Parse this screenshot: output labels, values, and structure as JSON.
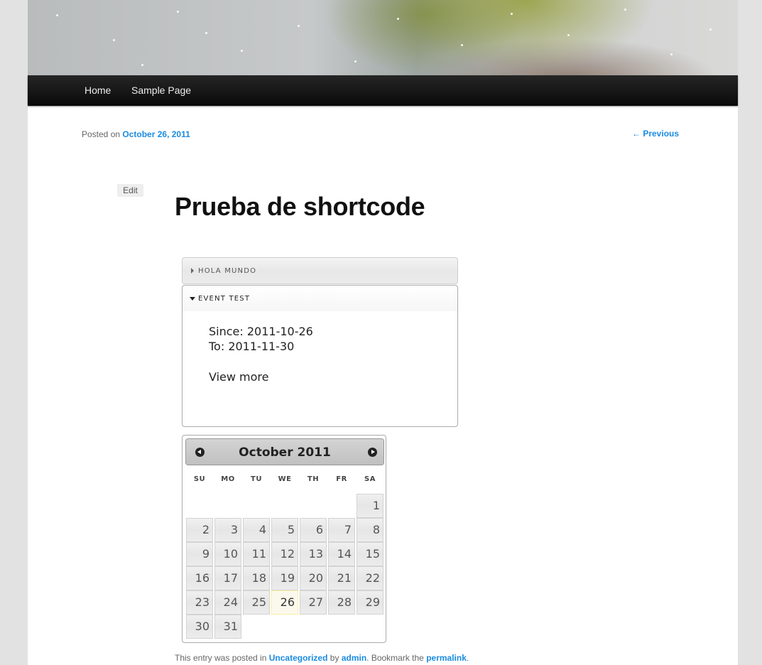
{
  "nav": {
    "items": [
      "Home",
      "Sample Page"
    ]
  },
  "post": {
    "posted_on_prefix": "Posted on",
    "date": "October 26, 2011",
    "previous_link": "← Previous",
    "edit_label": "Edit",
    "title": "Prueba de shortcode"
  },
  "accordion": {
    "collapsed_title": "HOLA MUNDO",
    "open_title": "EVENT TEST",
    "since": "Since: 2011-10-26",
    "to": "To: 2011-11-30",
    "view_more": "View more"
  },
  "calendar": {
    "title": "October 2011",
    "weekdays": [
      "SU",
      "MO",
      "TU",
      "WE",
      "TH",
      "FR",
      "SA"
    ],
    "first_weekday_index": 6,
    "days_in_month": 31,
    "highlighted_day": 26
  },
  "footer": {
    "prefix": "This entry was posted in",
    "category": "Uncategorized",
    "by": "by",
    "author": "admin",
    "bookmark": ". Bookmark the",
    "permalink": "permalink",
    "suffix": "."
  },
  "colors": {
    "link": "#1b8be0",
    "nav_background": "#111111",
    "today_highlight": "#fbf9ee"
  }
}
